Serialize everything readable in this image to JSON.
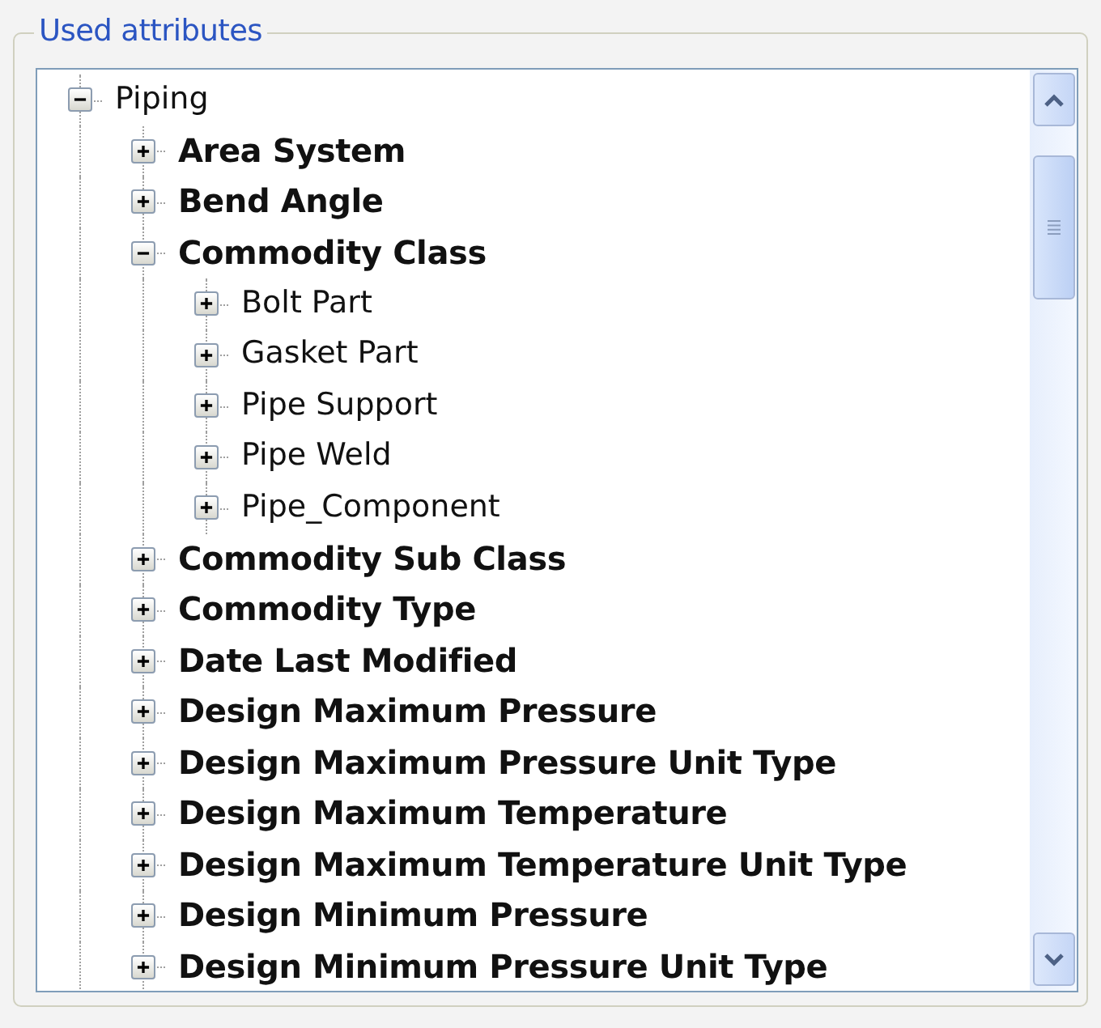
{
  "group": {
    "title": "Used attributes"
  },
  "tree": [
    {
      "label": "Piping",
      "expanded": true,
      "children": [
        {
          "label": "Area System",
          "expanded": false
        },
        {
          "label": "Bend Angle",
          "expanded": false
        },
        {
          "label": "Commodity Class",
          "expanded": true,
          "children": [
            {
              "label": "Bolt Part",
              "expanded": false
            },
            {
              "label": "Gasket Part",
              "expanded": false
            },
            {
              "label": "Pipe Support",
              "expanded": false
            },
            {
              "label": "Pipe Weld",
              "expanded": false
            },
            {
              "label": "Pipe_Component",
              "expanded": false
            }
          ]
        },
        {
          "label": "Commodity Sub Class",
          "expanded": false
        },
        {
          "label": "Commodity Type",
          "expanded": false
        },
        {
          "label": "Date Last Modified",
          "expanded": false
        },
        {
          "label": "Design Maximum Pressure",
          "expanded": false
        },
        {
          "label": "Design Maximum Pressure Unit Type",
          "expanded": false
        },
        {
          "label": "Design Maximum Temperature",
          "expanded": false
        },
        {
          "label": "Design Maximum Temperature Unit Type",
          "expanded": false
        },
        {
          "label": "Design Minimum Pressure",
          "expanded": false
        },
        {
          "label": "Design Minimum Pressure Unit Type",
          "expanded": false
        }
      ]
    }
  ]
}
